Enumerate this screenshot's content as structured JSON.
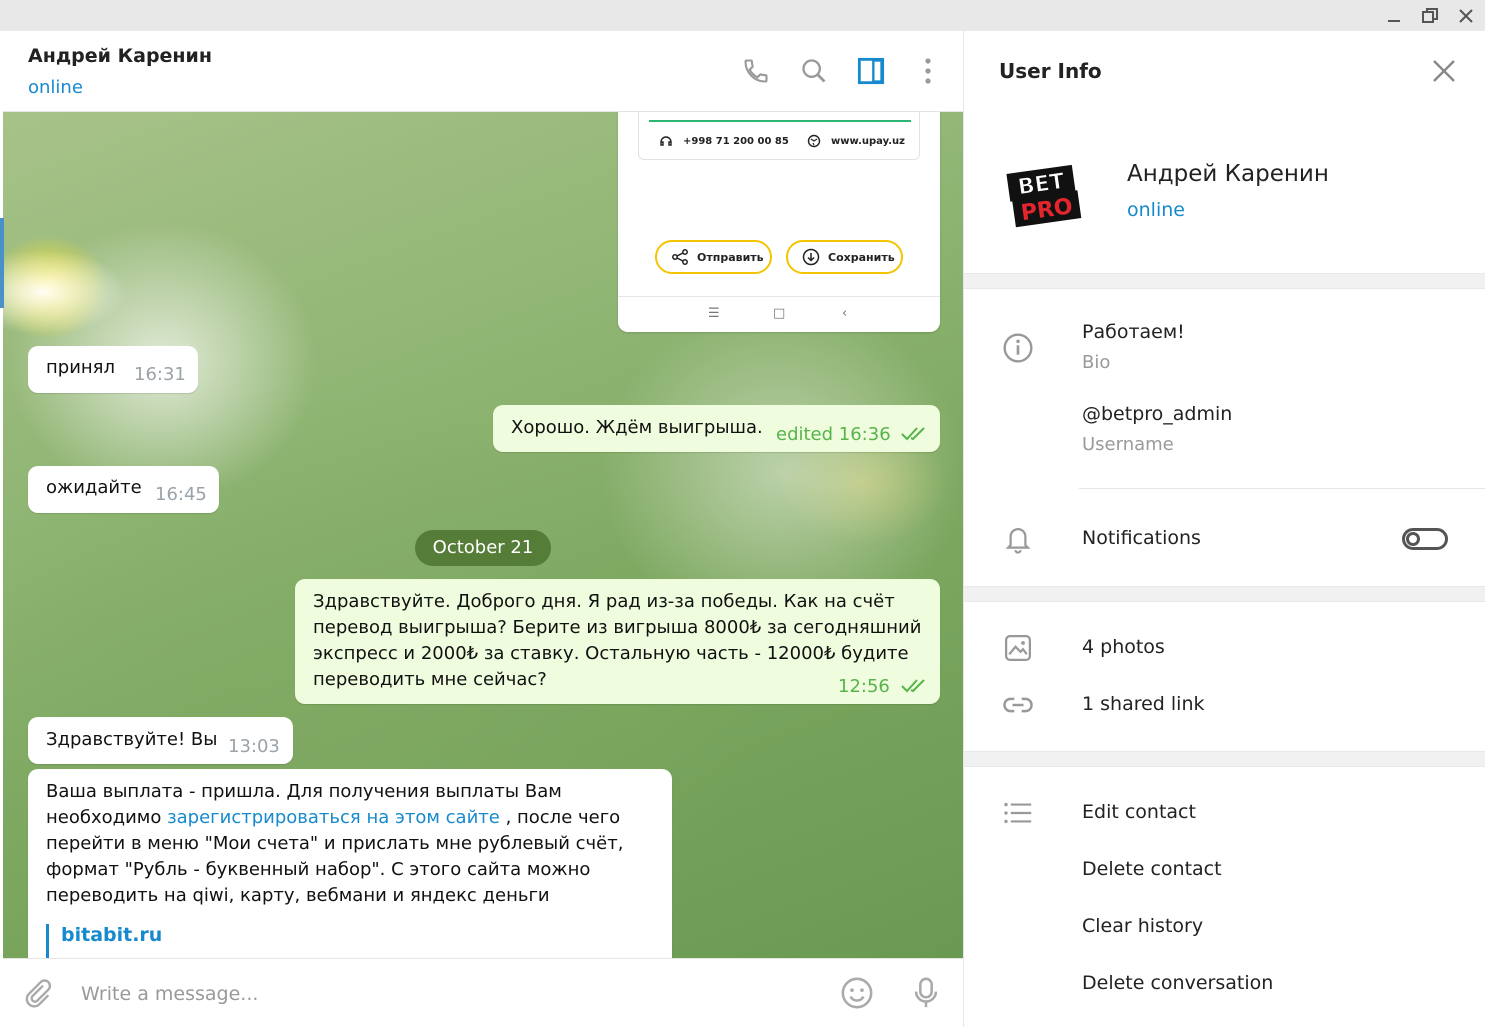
{
  "chat": {
    "name": "Андрей Каренин",
    "status": "online"
  },
  "card": {
    "phone": "+998 71 200 00 85",
    "site": "www.upay.uz",
    "send_label": "Отправить",
    "save_label": "Сохранить"
  },
  "messages": [
    {
      "text": "принял",
      "time": "16:31"
    },
    {
      "text": "Хорошо. Ждём выигрыша.",
      "time": "edited 16:36"
    },
    {
      "text": "ожидайте",
      "time": "16:45"
    },
    {
      "text": "Здравствуйте. Доброго дня. Я рад из-за победы. Как на счёт перевод выигрыша? Берите из вигрыша 8000₺ за сегодняшний экспресс и 2000₺ за ставку. Остальную часть - 12000₺ будите переводить мне сейчас?",
      "time": "12:56"
    },
    {
      "text": "Здравствуйте! Вы",
      "time": "13:03"
    },
    {
      "text_before": "Ваша выплата - пришла. Для получения выплаты Вам необходимо ",
      "link": "зарегистрироваться на этом сайте",
      "text_after": " ,  после чего перейти в меню \"Мои счета\" и прислать мне рублевый счёт, формат \"Рубль - буквенный набор\". С этого сайта можно переводить на qiwi, карту, вебмани и яндекс деньги",
      "preview_site": "bitabit.ru"
    }
  ],
  "date_divider": "October 21",
  "input": {
    "placeholder": "Write a message..."
  },
  "panel": {
    "title": "User Info",
    "name": "Андрей Каренин",
    "status": "online",
    "avatar_text": "BET PRO",
    "bio": "Работаем!",
    "bio_label": "Bio",
    "username": "@betpro_admin",
    "username_label": "Username",
    "notifications_label": "Notifications",
    "notifications_on": false,
    "photos": "4 photos",
    "links": "1 shared link",
    "actions": [
      "Edit contact",
      "Delete contact",
      "Clear history",
      "Delete conversation"
    ]
  },
  "colors": {
    "accent": "#168acd",
    "outgoing_bubble": "#effdde",
    "outgoing_time": "#57b34a",
    "date_pill": "#466e28",
    "card_button_border": "#f5c400"
  }
}
